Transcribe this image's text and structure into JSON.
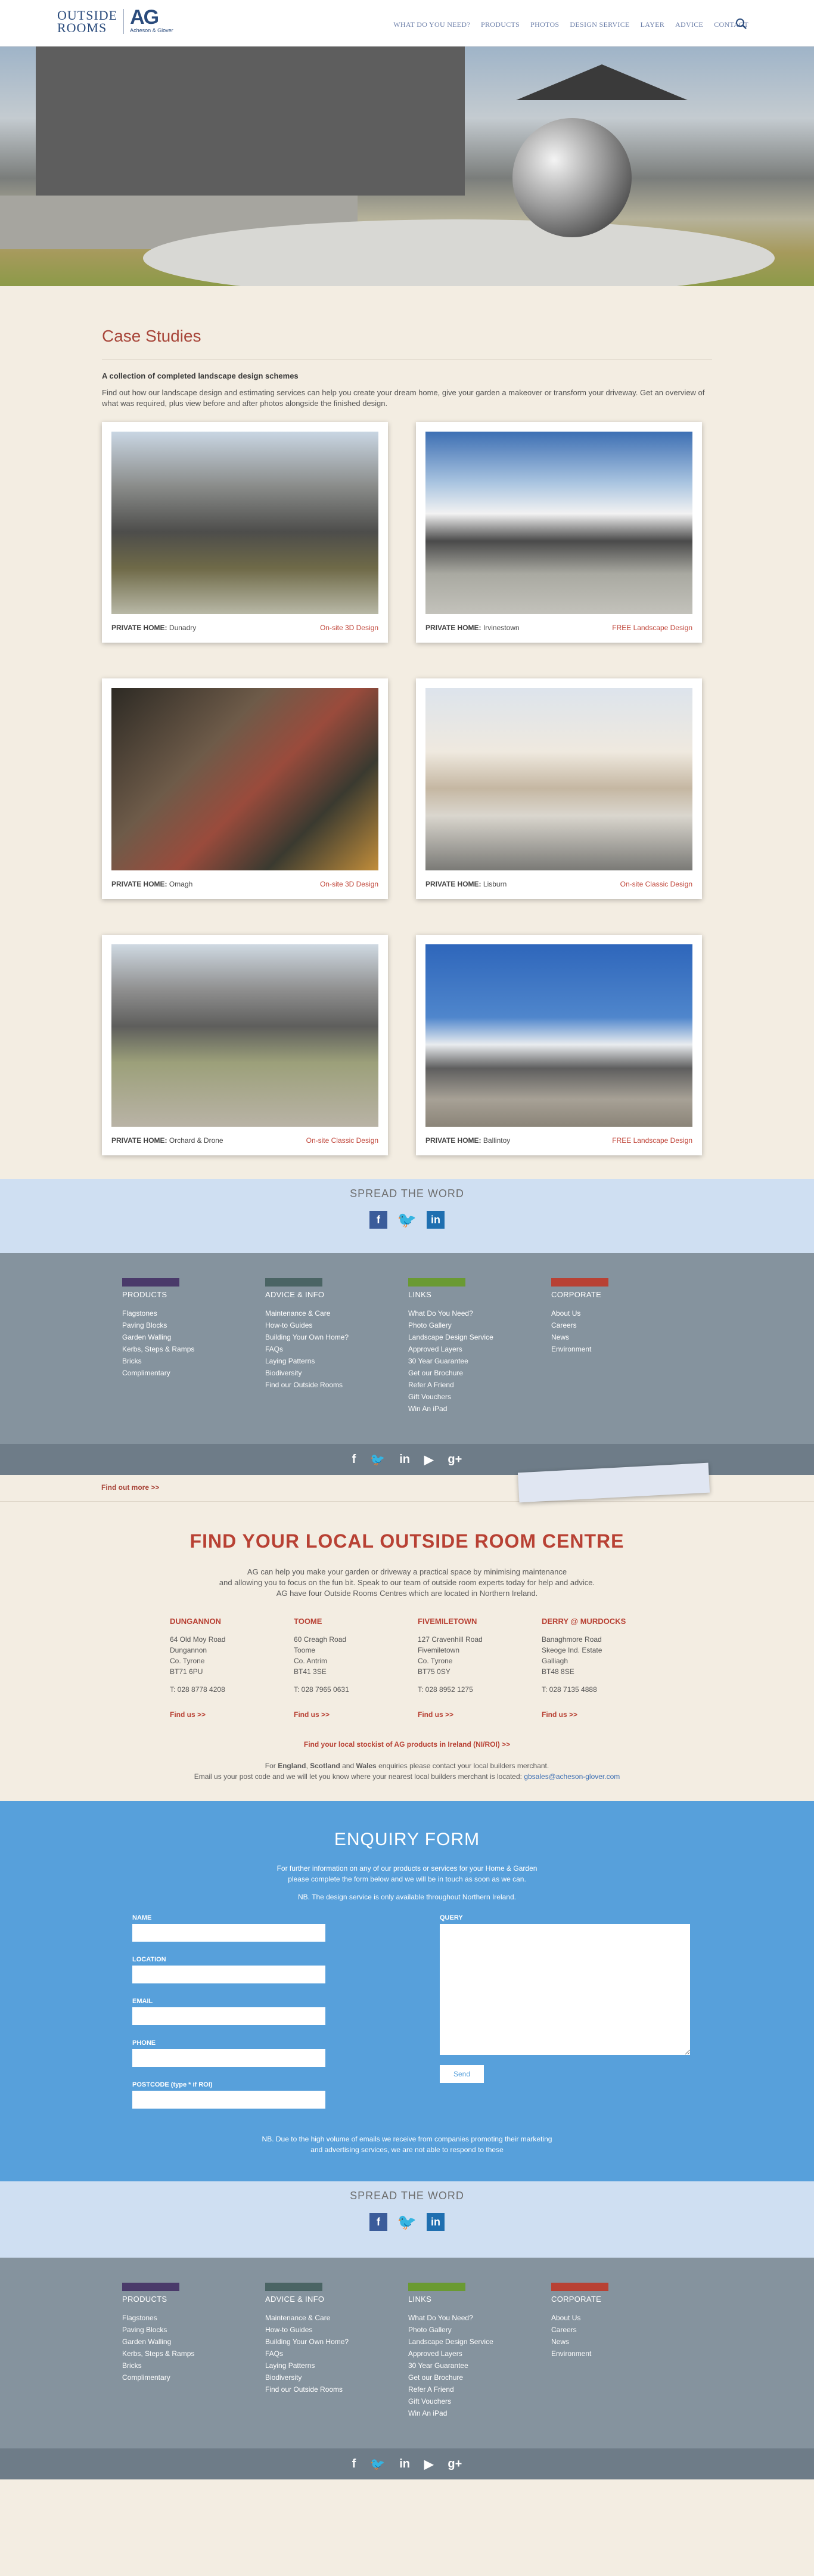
{
  "header": {
    "logo_text_line1": "OUTSIDE",
    "logo_text_line2": "ROOMS",
    "logo_mark": "AG",
    "logo_sub": "Acheson & Glover",
    "nav": [
      "WHAT DO YOU NEED?",
      "PRODUCTS",
      "PHOTOS",
      "DESIGN SERVICE",
      "LAYER",
      "ADVICE",
      "CONTACT"
    ],
    "search_icon": "search-icon"
  },
  "case_studies": {
    "title": "Case Studies",
    "subtitle": "A collection of completed landscape design schemes",
    "intro": "Find out how our landscape design and estimating services can help you create your dream home, give your garden a makeover or transform your driveway. Get an overview of what was required, plus view before and after photos alongside the finished design.",
    "items": [
      {
        "type": "PRIVATE HOME:",
        "place": "Dunadry",
        "service": "On-site 3D Design"
      },
      {
        "type": "PRIVATE HOME:",
        "place": "Irvinestown",
        "service": "FREE Landscape Design"
      },
      {
        "type": "PRIVATE HOME:",
        "place": "Omagh",
        "service": "On-site 3D Design"
      },
      {
        "type": "PRIVATE HOME:",
        "place": "Lisburn",
        "service": "On-site Classic Design"
      },
      {
        "type": "PRIVATE HOME:",
        "place": "Orchard & Drone",
        "service": "On-site Classic Design"
      },
      {
        "type": "PRIVATE HOME:",
        "place": "Ballintoy",
        "service": "FREE Landscape Design"
      }
    ]
  },
  "spread": {
    "title": "SPREAD THE WORD"
  },
  "footer": {
    "columns": [
      {
        "title": "PRODUCTS",
        "color": "#4a3a6a",
        "links": [
          "Flagstones",
          "Paving Blocks",
          "Garden Walling",
          "Kerbs, Steps & Ramps",
          "Bricks",
          "Complimentary"
        ]
      },
      {
        "title": "ADVICE & INFO",
        "color": "#4a6464",
        "links": [
          "Maintenance & Care",
          "How-to Guides",
          "Building Your Own Home?",
          "FAQs",
          "Laying Patterns",
          "Biodiversity",
          "Find our Outside Rooms"
        ]
      },
      {
        "title": "LINKS",
        "color": "#6a9a32",
        "links": [
          "What Do You Need?",
          "Photo Gallery",
          "Landscape Design Service",
          "Approved Layers",
          "30 Year Guarantee",
          "Get our Brochure",
          "Refer A Friend",
          "Gift Vouchers",
          "Win An iPad"
        ]
      },
      {
        "title": "CORPORATE",
        "color": "#b84134",
        "links": [
          "About Us",
          "Careers",
          "News",
          "Environment"
        ]
      }
    ]
  },
  "strip": {
    "find_out_more": "Find out more >>"
  },
  "local": {
    "title": "FIND YOUR LOCAL OUTSIDE ROOM CENTRE",
    "desc1": "AG can help you make your garden or driveway a practical space by minimising maintenance",
    "desc2": "and allowing you to focus on the fun bit. Speak to our team of outside room experts today for help and advice.",
    "desc3": "AG have four Outside Rooms Centres which are located in Northern Ireland.",
    "branches": [
      {
        "name": "DUNGANNON",
        "addr": [
          "64 Old Moy Road",
          "Dungannon",
          "Co. Tyrone",
          "BT71 6PU"
        ],
        "tel": "T: 028 8778 4208",
        "find": "Find us >>"
      },
      {
        "name": "TOOME",
        "addr": [
          "60 Creagh Road",
          "Toome",
          "Co. Antrim",
          "BT41 3SE"
        ],
        "tel": "T: 028 7965 0631",
        "find": "Find us >>"
      },
      {
        "name": "FIVEMILETOWN",
        "addr": [
          "127 Cravenhill Road",
          "Fivemiletown",
          "Co. Tyrone",
          "BT75 0SY"
        ],
        "tel": "T: 028 8952 1275",
        "find": "Find us >>"
      },
      {
        "name": "DERRY @ MURDOCKS",
        "addr": [
          "Banaghmore Road",
          "Skeoge Ind. Estate",
          "Galliagh",
          "BT48 8SE"
        ],
        "tel": "T: 028 7135 4888",
        "find": "Find us >>"
      }
    ],
    "stockist": "Find your local stockist of AG products in Ireland (NI/ROI) >>",
    "england_pre": "For ",
    "england_b1": "England",
    "england_mid1": ", ",
    "england_b2": "Scotland",
    "england_mid2": " and ",
    "england_b3": "Wales",
    "england_post": " enquiries please contact your local builders merchant.",
    "mail_text": "Email us your post code and we will let you know where your nearest local builders merchant is located: ",
    "mail_link": "gbsales@acheson-glover.com"
  },
  "enquiry": {
    "title": "ENQUIRY FORM",
    "lead1": "For further information on any of our products or services for your Home & Garden",
    "lead2": "please complete the form below and we will be in touch as soon as we can.",
    "note": "NB. The design service is only available throughout Northern Ireland.",
    "fields": [
      "NAME",
      "LOCATION",
      "EMAIL",
      "PHONE",
      "POSTCODE (type * if ROI)"
    ],
    "query_label": "QUERY",
    "send": "Send",
    "foot1": "NB. Due to the high volume of emails we receive from companies promoting their marketing",
    "foot2": "and advertising services, we are not able to respond to these"
  },
  "social": [
    "facebook-icon",
    "twitter-icon",
    "linkedin-icon"
  ],
  "bottom_social": [
    "facebook-icon",
    "twitter-icon",
    "linkedin-icon",
    "youtube-icon",
    "googleplus-icon"
  ]
}
